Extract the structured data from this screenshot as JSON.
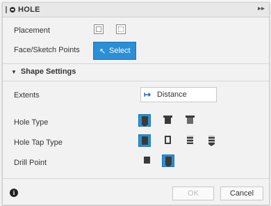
{
  "window": {
    "title": "HOLE",
    "expand_symbol": "▸▸"
  },
  "rows": {
    "placement_label": "Placement",
    "face_sketch_label": "Face/Sketch Points",
    "select_label": "Select",
    "extents_label": "Extents",
    "hole_type_label": "Hole Type",
    "hole_tap_type_label": "Hole Tap Type",
    "drill_point_label": "Drill Point"
  },
  "section": {
    "label": "Shape Settings",
    "expanded": true
  },
  "extents": {
    "value": "Distance"
  },
  "hole_type": {
    "options": [
      "simple",
      "counterbore",
      "countersink"
    ],
    "selected": "simple"
  },
  "hole_tap_type": {
    "options": [
      "simple",
      "clearance",
      "tapped",
      "taper-tapped"
    ],
    "selected": "simple"
  },
  "drill_point": {
    "options": [
      "flat",
      "angled"
    ],
    "selected": "angled"
  },
  "footer": {
    "info_symbol": "i",
    "ok_label": "OK",
    "cancel_label": "Cancel",
    "ok_enabled": false
  },
  "colors": {
    "accent": "#2b8fd7",
    "accent_border": "#1e73b2",
    "panel": "#f2f2f2",
    "titlebar": "#e8e8e8"
  }
}
